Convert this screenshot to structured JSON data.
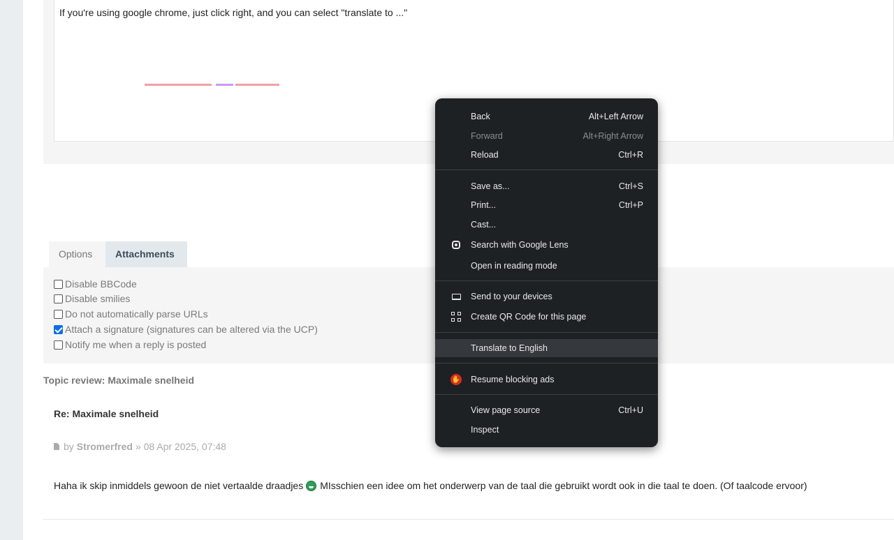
{
  "editor": {
    "text": "If you're using google chrome, just click right, and you can select \"translate to ...\""
  },
  "tabs": [
    {
      "label": "Options"
    },
    {
      "label": "Attachments"
    }
  ],
  "options": [
    {
      "label": "Disable BBCode",
      "checked": false
    },
    {
      "label": "Disable smilies",
      "checked": false
    },
    {
      "label": "Do not automatically parse URLs",
      "checked": false
    },
    {
      "label": "Attach a signature (signatures can be altered via the UCP)",
      "checked": true
    },
    {
      "label": "Notify me when a reply is posted",
      "checked": false
    }
  ],
  "topic_review": {
    "heading": "Topic review: Maximale snelheid",
    "post": {
      "title": "Re: Maximale snelheid",
      "by": "by",
      "author": "Stromerfred",
      "date": "» 08 Apr 2025, 07:48",
      "body_part1": "Haha ik skip inmiddels gewoon de niet vertaalde draadjes",
      "body_part2": "MIsschien een idee om het onderwerp van de taal die gebruikt wordt ook in die taal te doen. (Of taalcode ervoor)"
    }
  },
  "context_menu": {
    "items": [
      {
        "label": "Back",
        "shortcut": "Alt+Left Arrow"
      },
      {
        "label": "Forward",
        "shortcut": "Alt+Right Arrow",
        "disabled": true
      },
      {
        "label": "Reload",
        "shortcut": "Ctrl+R"
      },
      {
        "label": "Save as...",
        "shortcut": "Ctrl+S"
      },
      {
        "label": "Print...",
        "shortcut": "Ctrl+P"
      },
      {
        "label": "Cast...",
        "shortcut": ""
      },
      {
        "label": "Search with Google Lens",
        "shortcut": "",
        "icon": "google-lens-icon"
      },
      {
        "label": "Open in reading mode",
        "shortcut": ""
      },
      {
        "label": "Send to your devices",
        "shortcut": "",
        "icon": "devices-icon"
      },
      {
        "label": "Create QR Code for this page",
        "shortcut": "",
        "icon": "qr-code-icon"
      },
      {
        "label": "Translate to English",
        "shortcut": "",
        "highlighted": true
      },
      {
        "label": "Resume blocking ads",
        "shortcut": "",
        "icon": "stop-hand-icon"
      },
      {
        "label": "View page source",
        "shortcut": "Ctrl+U"
      },
      {
        "label": "Inspect",
        "shortcut": ""
      }
    ]
  },
  "colors": {
    "menu_bg": "#1e2124",
    "menu_highlight": "#35383c",
    "checkbox_checked": "#0b6fe5",
    "adblock_red": "#d92c20",
    "spellcheck_red": "#f0a0a8",
    "spellcheck_purple": "#c79cf0"
  }
}
